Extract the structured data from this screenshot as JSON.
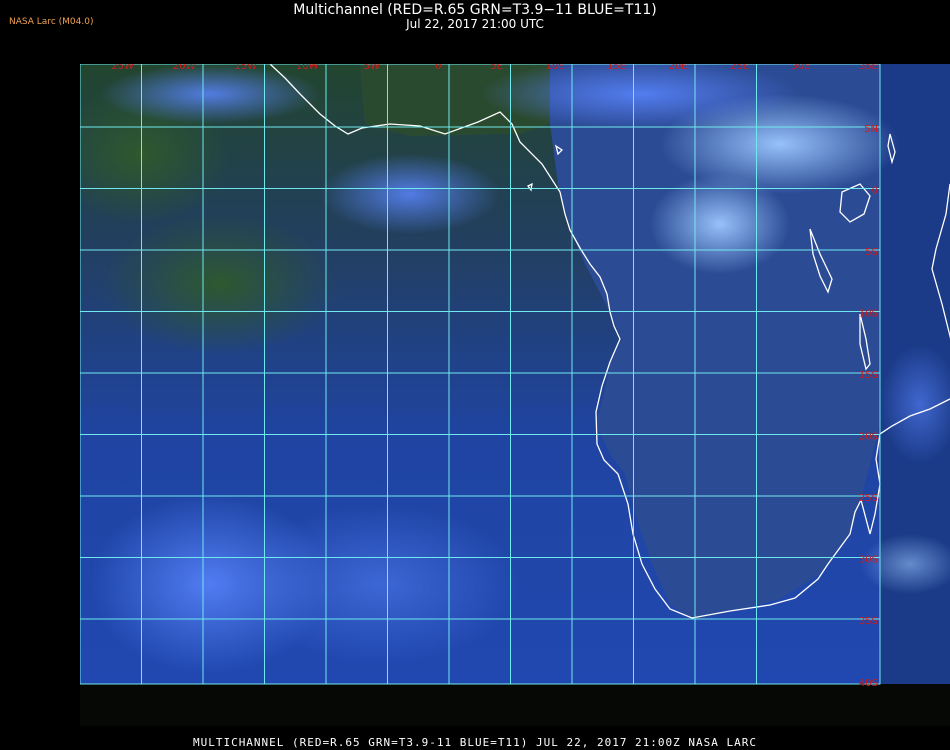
{
  "header": {
    "title": "Multichannel (RED=R.65 GRN=T3.9−11 BLUE=T11)",
    "subtitle": "Jul 22, 2017 21:00 UTC",
    "brand": "NASA Larc (M04.0)"
  },
  "footer": {
    "caption": "MULTICHANNEL (RED=R.65 GRN=T3.9-11 BLUE=T11) JUL 22, 2017 21:00Z   NASA LARC"
  },
  "map": {
    "longitude_labels": [
      "25W",
      "20W",
      "15W",
      "10W",
      "5W",
      "0",
      "5E",
      "10E",
      "15E",
      "20E",
      "25E",
      "30E",
      "35E"
    ],
    "latitude_labels": [
      "5N",
      "0",
      "5S",
      "10S",
      "15S",
      "20S",
      "25S",
      "30S",
      "35S",
      "40S"
    ],
    "colors": {
      "grid": "#6fe9ee",
      "label": "#d11a1a",
      "coastline": "#ffffff",
      "ocean": "#1e3fa8",
      "land": "#2c4b95",
      "cloud_high": "#7fb0ff",
      "cloud_low": "#2f5a2c"
    }
  }
}
